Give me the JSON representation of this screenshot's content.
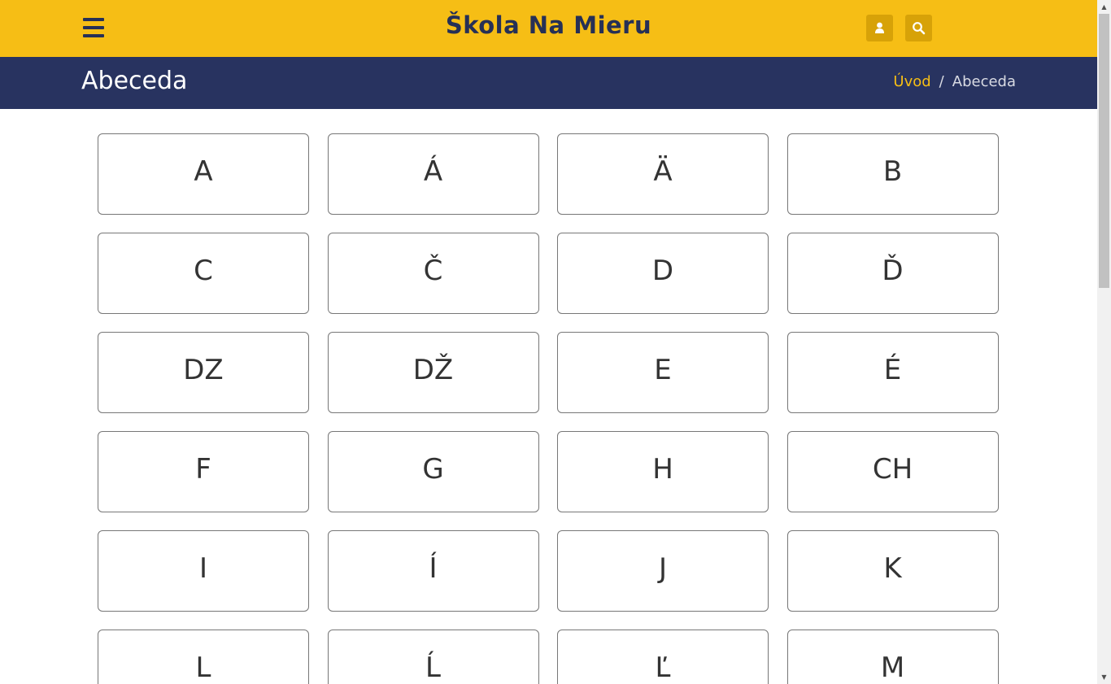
{
  "header": {
    "site_title": "Škola Na Mieru",
    "menu_icon": "hamburger-menu-icon",
    "user_icon": "user-icon",
    "search_icon": "search-icon",
    "colors": {
      "navbar": "#f6be15",
      "subheader": "#283360",
      "accent": "#f6be15",
      "icon_button": "#d7a208"
    }
  },
  "subheader": {
    "page_title": "Abeceda",
    "breadcrumb": {
      "home": "Úvod",
      "separator": "/",
      "current": "Abeceda"
    }
  },
  "letters": [
    "A",
    "Á",
    "Ä",
    "B",
    "C",
    "Č",
    "D",
    "Ď",
    "DZ",
    "DŽ",
    "E",
    "É",
    "F",
    "G",
    "H",
    "CH",
    "I",
    "Í",
    "J",
    "K",
    "L",
    "Ĺ",
    "Ľ",
    "M"
  ]
}
